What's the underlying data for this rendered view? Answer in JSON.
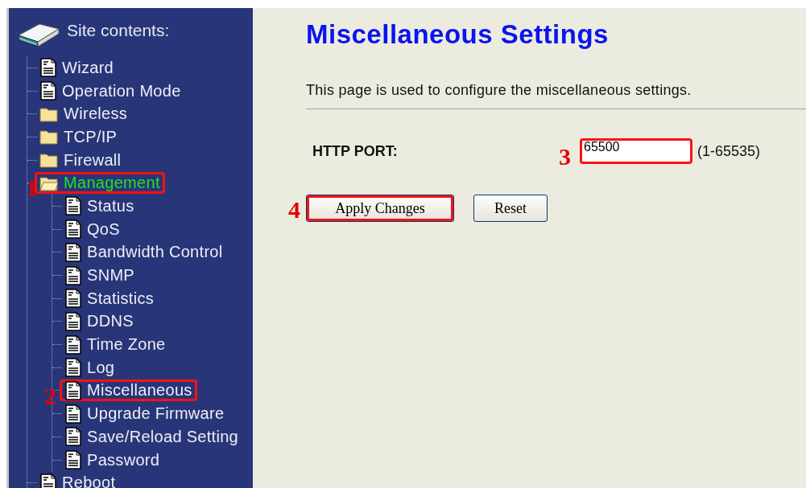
{
  "sidebar": {
    "title": "Site contents:",
    "items": [
      {
        "label": "Wizard",
        "kind": "page",
        "selected": false
      },
      {
        "label": "Operation Mode",
        "kind": "page",
        "selected": false
      },
      {
        "label": "Wireless",
        "kind": "folder",
        "selected": false,
        "expanded": false
      },
      {
        "label": "TCP/IP",
        "kind": "folder",
        "selected": false,
        "expanded": false
      },
      {
        "label": "Firewall",
        "kind": "folder",
        "selected": false,
        "expanded": false
      },
      {
        "label": "Management",
        "kind": "folder",
        "selected": true,
        "expanded": true,
        "callout": "1",
        "children": [
          {
            "label": "Status",
            "kind": "page",
            "selected": false
          },
          {
            "label": "QoS",
            "kind": "page",
            "selected": false
          },
          {
            "label": "Bandwidth Control",
            "kind": "page",
            "selected": false
          },
          {
            "label": "SNMP",
            "kind": "page",
            "selected": false
          },
          {
            "label": "Statistics",
            "kind": "page",
            "selected": false
          },
          {
            "label": "DDNS",
            "kind": "page",
            "selected": false
          },
          {
            "label": "Time Zone",
            "kind": "page",
            "selected": false
          },
          {
            "label": "Log",
            "kind": "page",
            "selected": false
          },
          {
            "label": "Miscellaneous",
            "kind": "page",
            "selected": false,
            "callout": "2"
          },
          {
            "label": "Upgrade Firmware",
            "kind": "page",
            "selected": false
          },
          {
            "label": "Save/Reload Setting",
            "kind": "page",
            "selected": false
          },
          {
            "label": "Password",
            "kind": "page",
            "selected": false
          }
        ]
      },
      {
        "label": "Reboot",
        "kind": "page",
        "selected": false
      }
    ]
  },
  "main": {
    "title": "Miscellaneous Settings",
    "description": "This page is used to configure the miscellaneous settings.",
    "field": {
      "label": "HTTP PORT:",
      "value": "65500",
      "hint": "(1-65535)",
      "callout": "3"
    },
    "buttons": [
      {
        "label": "Apply Changes",
        "callout": "4"
      },
      {
        "label": "Reset"
      }
    ]
  }
}
